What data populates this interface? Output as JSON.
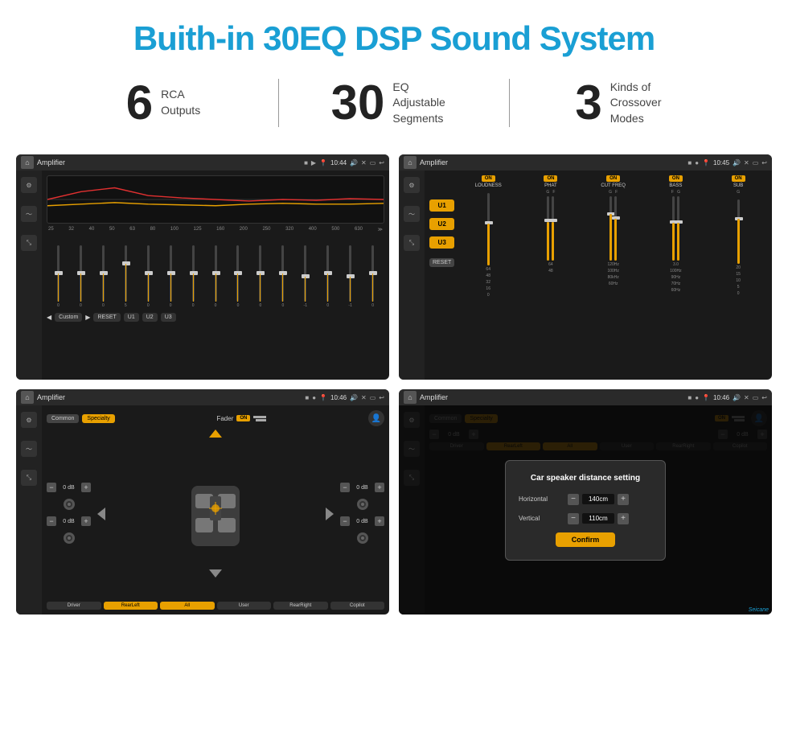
{
  "page": {
    "title": "Buith-in 30EQ DSP Sound System",
    "stats": [
      {
        "number": "6",
        "label": "RCA\nOutputs"
      },
      {
        "number": "30",
        "label": "EQ Adjustable\nSegments"
      },
      {
        "number": "3",
        "label": "Kinds of\nCrossover Modes"
      }
    ]
  },
  "screen1": {
    "title": "Amplifier",
    "time": "10:44",
    "eq_freqs": [
      "25",
      "32",
      "40",
      "50",
      "63",
      "80",
      "100",
      "125",
      "160",
      "200",
      "250",
      "320",
      "400",
      "500",
      "630"
    ],
    "eq_vals": [
      "0",
      "0",
      "0",
      "5",
      "0",
      "0",
      "0",
      "0",
      "0",
      "0",
      "0",
      "-1",
      "0",
      "-1"
    ],
    "bottom_buttons": [
      "Custom",
      "RESET",
      "U1",
      "U2",
      "U3"
    ]
  },
  "screen2": {
    "title": "Amplifier",
    "time": "10:45",
    "presets": [
      "U1",
      "U2",
      "U3"
    ],
    "reset_label": "RESET",
    "columns": [
      {
        "label": "LOUDNESS",
        "on": true
      },
      {
        "label": "PHAT",
        "on": true
      },
      {
        "label": "CUT FREQ",
        "on": true
      },
      {
        "label": "BASS",
        "on": true
      },
      {
        "label": "SUB",
        "on": true
      }
    ]
  },
  "screen3": {
    "title": "Amplifier",
    "time": "10:46",
    "tabs": [
      "Common",
      "Specialty"
    ],
    "active_tab": "Specialty",
    "fader_label": "Fader",
    "on_badge": "ON",
    "positions": [
      "Driver",
      "RearLeft",
      "All",
      "User",
      "RearRight",
      "Copilot"
    ],
    "active_position": "All",
    "db_values": [
      "0 dB",
      "0 dB",
      "0 dB",
      "0 dB"
    ]
  },
  "screen4": {
    "title": "Amplifier",
    "time": "10:46",
    "tabs": [
      "Common",
      "Specialty"
    ],
    "dialog": {
      "title": "Car speaker distance setting",
      "horizontal_label": "Horizontal",
      "horizontal_value": "140cm",
      "vertical_label": "Vertical",
      "vertical_value": "110cm",
      "confirm_label": "Confirm"
    },
    "positions": [
      "Driver",
      "RearLeft",
      "All",
      "User",
      "RearRight",
      "Copilot"
    ],
    "db_values": [
      "0 dB",
      "0 dB"
    ]
  },
  "watermark": "Seicane"
}
